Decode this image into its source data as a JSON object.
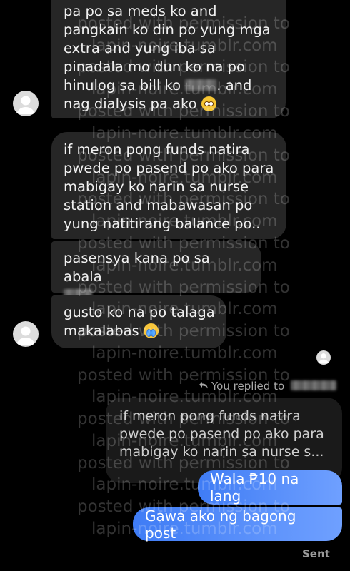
{
  "received": [
    {
      "lines": [
        "pa po sa meds ko and",
        "pangkain ko din po yung mga",
        "extra and yung iba sa",
        "pinadala mo dun ko na po"
      ],
      "line5_pre": "hinulog sa bill ko",
      "line5_post": ". and",
      "line6": "nag dialysis pa ako"
    },
    {
      "lines": [
        "if meron pong funds natira",
        "pwede po pasend po ako para",
        "mabigay ko narin sa nurse",
        "station and mabawasan po",
        "yung natitirang balance po.."
      ]
    },
    {
      "line1": "pasensya kana po sa abala",
      "line2_post": "."
    },
    {
      "line1": "gusto ko na po talaga",
      "line2": "makalabas"
    }
  ],
  "reply_header": "You replied to",
  "reply_quote": [
    "if meron pong funds natira",
    "pwede po pasend po ako para",
    "mabigay ko narin sa nurse s..."
  ],
  "sent": [
    "Wala ₱10 na lang",
    "Gawa ako ng bagong post"
  ],
  "status": "Sent",
  "watermark": [
    "posted with permission to",
    "lapin-noire.tumblr.com"
  ],
  "colors": {
    "received_bg": "#262626",
    "sent_start": "#3f7cf5",
    "sent_end": "#6fa0ff"
  }
}
